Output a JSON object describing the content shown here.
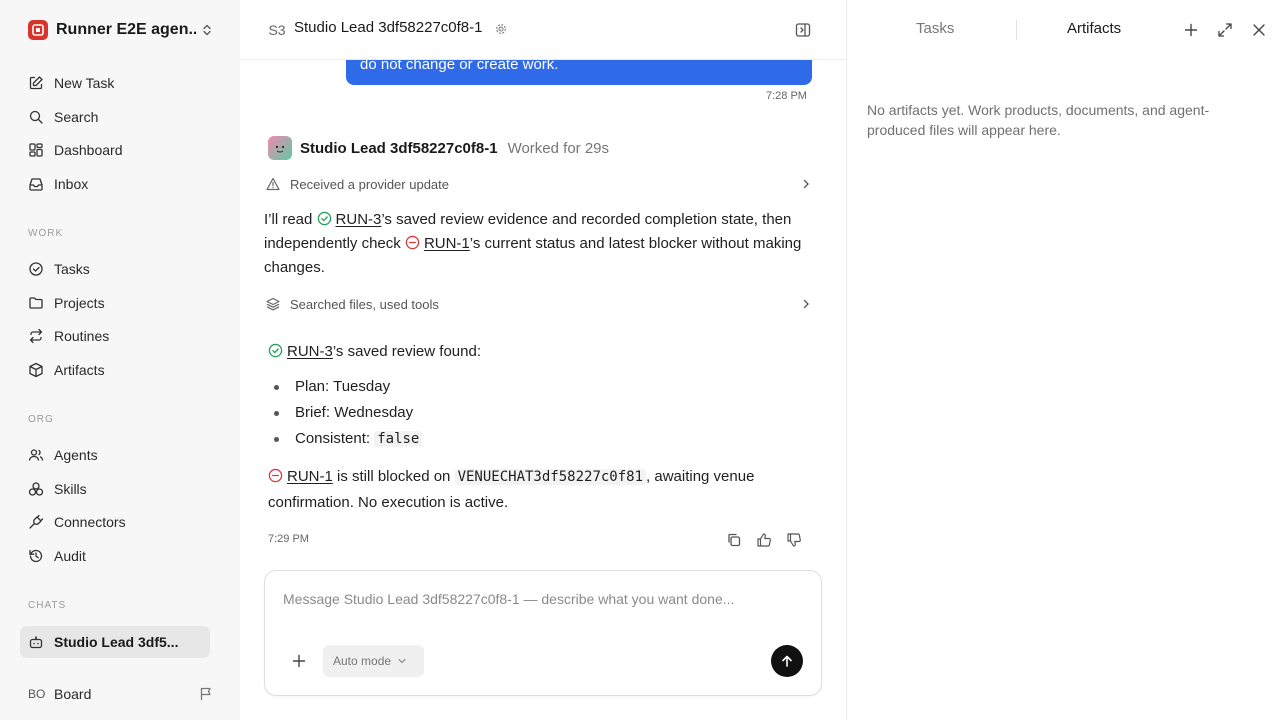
{
  "sidebar": {
    "workspace_name": "Runner E2E agen...",
    "items_top": [
      {
        "label": "New Task",
        "icon": "edit-icon"
      },
      {
        "label": "Search",
        "icon": "search-icon"
      },
      {
        "label": "Dashboard",
        "icon": "dashboard-icon"
      },
      {
        "label": "Inbox",
        "icon": "inbox-icon"
      }
    ],
    "section_work": "WORK",
    "items_work": [
      {
        "label": "Tasks",
        "icon": "check-circle-icon"
      },
      {
        "label": "Projects",
        "icon": "folder-icon"
      },
      {
        "label": "Routines",
        "icon": "repeat-icon"
      },
      {
        "label": "Artifacts",
        "icon": "box-icon"
      }
    ],
    "section_org": "ORG",
    "items_org": [
      {
        "label": "Agents",
        "icon": "users-icon"
      },
      {
        "label": "Skills",
        "icon": "skills-icon"
      },
      {
        "label": "Connectors",
        "icon": "plug-icon"
      },
      {
        "label": "Audit",
        "icon": "history-icon"
      }
    ],
    "section_chats": "CHATS",
    "chats": [
      {
        "label": "Studio Lead 3df5...",
        "icon": "bot-icon"
      }
    ],
    "footer": {
      "initials": "BO",
      "label": "Board"
    }
  },
  "chat": {
    "badge": "S3",
    "title": "Studio Lead 3df58227c0f8-1",
    "user_message_tail": "do not change or create work.",
    "user_message_time": "7:28 PM",
    "agent_name": "Studio Lead 3df58227c0f8-1",
    "worked_for": "Worked for 29s",
    "tool_row_1": "Received a provider update",
    "intro": {
      "p1": "I’ll read ",
      "link1": "RUN-3",
      "p2": "’s saved review evidence and recorded completion state, then independently check ",
      "link2": "RUN-1",
      "p3": "’s current status and latest blocker without making changes."
    },
    "tool_row_2": "Searched files, used tools",
    "review": {
      "link": "RUN-3",
      "text": "’s saved review found:"
    },
    "bullets": [
      {
        "label": "Plan: ",
        "value": "Tuesday"
      },
      {
        "label": "Brief: ",
        "value": "Wednesday"
      },
      {
        "label": "Consistent: ",
        "value": "false"
      }
    ],
    "blocker": {
      "link": "RUN-1",
      "p1": " is still blocked on ",
      "code": "VENUECHAT3df58227c0f81",
      "p2": ", awaiting venue confirmation. No execution is active."
    },
    "agent_message_time": "7:29 PM",
    "composer": {
      "placeholder": "Message Studio Lead 3df58227c0f8-1 — describe what you want done...",
      "mode": "Auto mode"
    }
  },
  "right_panel": {
    "tabs": [
      "Tasks",
      "Artifacts"
    ],
    "active_tab": "Artifacts",
    "empty_text": "No artifacts yet. Work products, documents, and agent-produced files will appear here."
  },
  "colors": {
    "accent_blue": "#2f6be8",
    "success_green": "#22a05a",
    "blocked_red": "#d93a3a",
    "logo_red": "#d9342b"
  }
}
